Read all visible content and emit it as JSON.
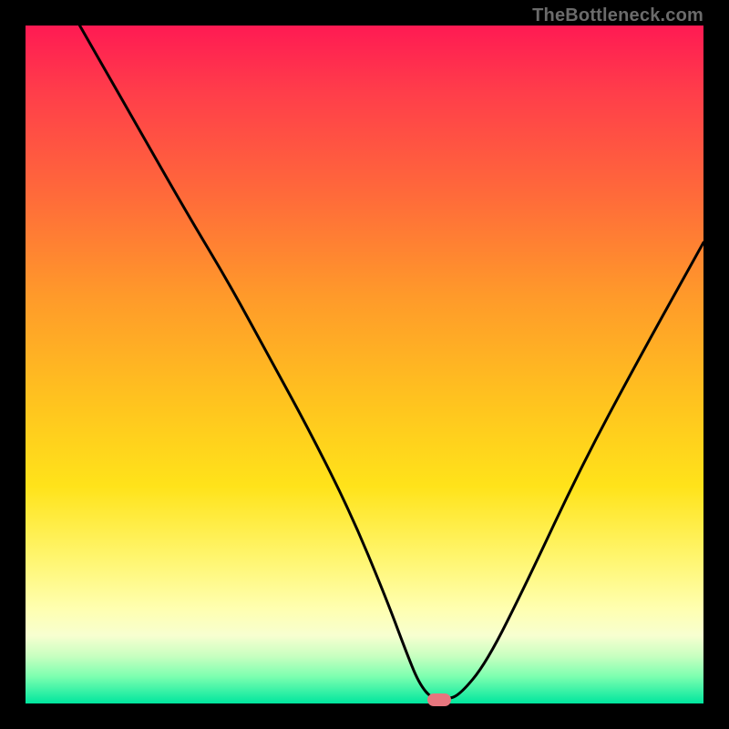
{
  "watermark": "TheBottleneck.com",
  "chart_data": {
    "type": "line",
    "title": "",
    "xlabel": "",
    "ylabel": "",
    "xlim": [
      0,
      100
    ],
    "ylim": [
      0,
      100
    ],
    "grid": false,
    "series": [
      {
        "name": "curve",
        "x": [
          8,
          16,
          24,
          30,
          36,
          42,
          48,
          53,
          56,
          58,
          60,
          62,
          64,
          68,
          74,
          82,
          90,
          100
        ],
        "y": [
          100,
          86,
          72,
          62,
          51,
          40,
          28,
          16,
          8,
          3,
          0.6,
          0.6,
          1.2,
          6,
          18,
          35,
          50,
          68
        ]
      }
    ],
    "marker": {
      "x": 61,
      "y": 0.6
    },
    "colors": {
      "curve": "#000000",
      "marker": "#e7767e",
      "gradient_top": "#ff1a53",
      "gradient_bottom": "#00e69e"
    }
  }
}
